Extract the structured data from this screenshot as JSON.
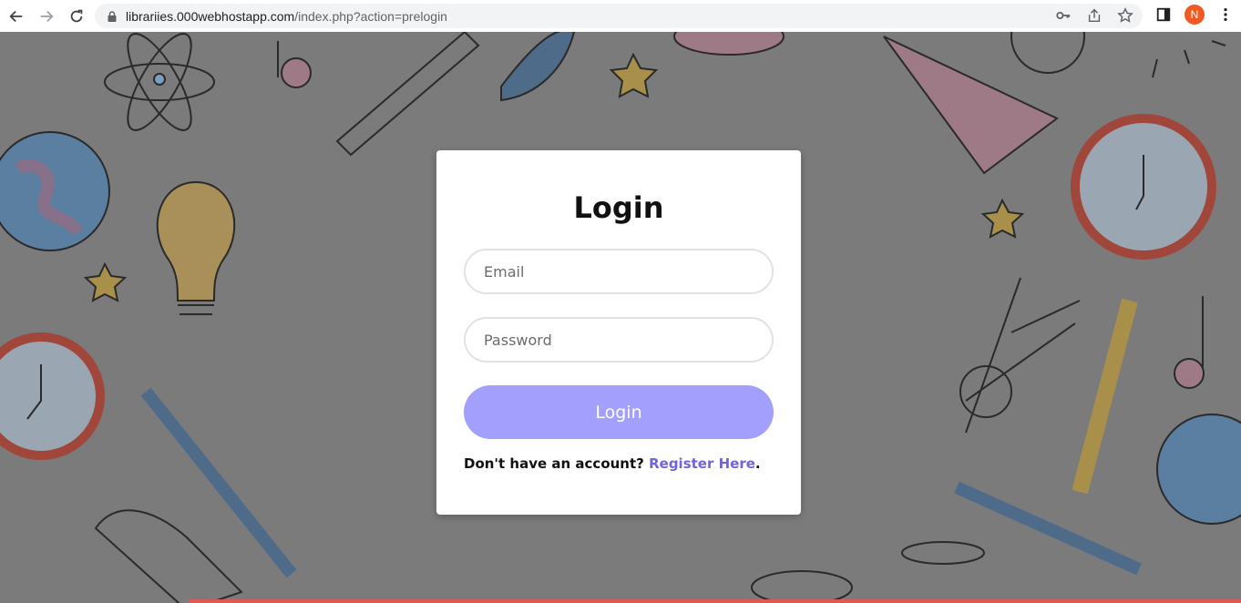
{
  "browser": {
    "url_host": "librariies.000webhostapp.com",
    "url_path": "/index.php?action=prelogin",
    "avatar_letter": "N"
  },
  "login": {
    "title": "Login",
    "email_placeholder": "Email",
    "password_placeholder": "Password",
    "submit_label": "Login",
    "register_prompt": "Don't have an account?",
    "register_link": "Register Here",
    "register_suffix": "."
  },
  "colors": {
    "accent": "#a39ffc",
    "link": "#6f64db",
    "background_overlay": "#7b7b7b"
  }
}
